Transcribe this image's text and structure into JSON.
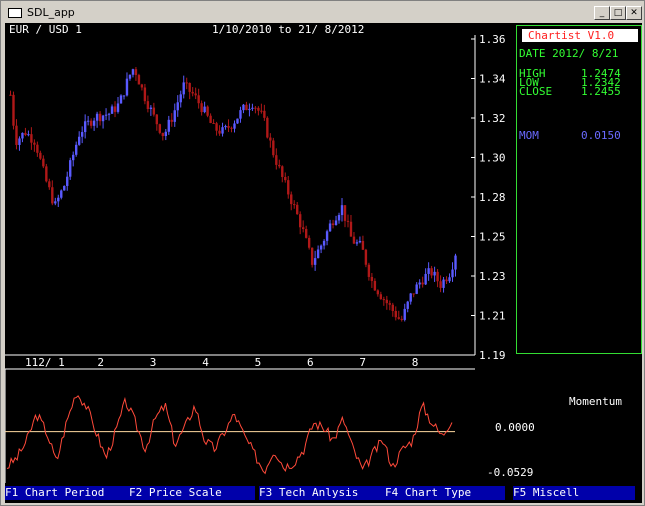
{
  "window": {
    "title": "SDL_app",
    "minimize": "_",
    "maximize": "□",
    "close": "✕"
  },
  "chart_header": {
    "pair": "EUR / USD 1",
    "range": "1/10/2010 to 21/ 8/2012"
  },
  "info_panel": {
    "app_name": "Chartist V1.0",
    "date": "DATE 2012/ 8/21",
    "high_label": "HIGH",
    "high": "1.2474",
    "low_label": "LOW",
    "low": "1.2342",
    "close_label": "CLOSE",
    "close": "1.2455",
    "mom_label": "MOM",
    "mom": "0.0150"
  },
  "indicator": {
    "name": "Momentum",
    "zero": "0.0000",
    "min": "-0.0529"
  },
  "function_keys": [
    "F1 Chart Period",
    "F2 Price Scale",
    "F3 Tech Anlysis",
    "F4 Chart Type",
    "F5 Miscell"
  ],
  "colors": {
    "up": "#5a5aff",
    "down": "#b01818",
    "panel_border": "#33dd33",
    "label_green": "#33ff33",
    "mom_blue": "#6a6aff",
    "title_red": "#ff2020",
    "momentum_line": "#ff4a3a"
  },
  "chart_data": {
    "type": "candlestick",
    "title": "EUR / USD 1",
    "subtitle": "1/10/2010 to 21/ 8/2012",
    "y_ticks": [
      "1.36",
      "1.34",
      "1.32",
      "1.30",
      "1.28",
      "1.25",
      "1.23",
      "1.21",
      "1.19"
    ],
    "x_ticks": [
      "112/ 1",
      "2",
      "3",
      "4",
      "5",
      "6",
      "7",
      "8"
    ],
    "ylim": [
      1.19,
      1.36
    ],
    "price_path": [
      [
        0,
        1.33
      ],
      [
        1,
        1.305
      ],
      [
        3,
        1.31
      ],
      [
        5,
        1.305
      ],
      [
        7,
        1.285
      ],
      [
        9,
        1.27
      ],
      [
        11,
        1.282
      ],
      [
        14,
        1.31
      ],
      [
        17,
        1.318
      ],
      [
        20,
        1.32
      ],
      [
        22,
        1.325
      ],
      [
        24,
        1.34
      ],
      [
        25,
        1.345
      ],
      [
        27,
        1.33
      ],
      [
        29,
        1.318
      ],
      [
        31,
        1.308
      ],
      [
        33,
        1.32
      ],
      [
        35,
        1.335
      ],
      [
        37,
        1.33
      ],
      [
        39,
        1.322
      ],
      [
        41,
        1.312
      ],
      [
        43,
        1.31
      ],
      [
        45,
        1.315
      ],
      [
        47,
        1.322
      ],
      [
        49,
        1.326
      ],
      [
        51,
        1.318
      ],
      [
        53,
        1.3
      ],
      [
        55,
        1.285
      ],
      [
        57,
        1.272
      ],
      [
        59,
        1.258
      ],
      [
        61,
        1.24
      ],
      [
        63,
        1.25
      ],
      [
        65,
        1.262
      ],
      [
        67,
        1.27
      ],
      [
        69,
        1.252
      ],
      [
        71,
        1.248
      ],
      [
        73,
        1.23
      ],
      [
        75,
        1.222
      ],
      [
        77,
        1.215
      ],
      [
        79,
        1.208
      ],
      [
        81,
        1.222
      ],
      [
        83,
        1.23
      ],
      [
        85,
        1.235
      ],
      [
        87,
        1.228
      ],
      [
        89,
        1.235
      ],
      [
        90,
        1.245
      ]
    ],
    "momentum": {
      "name": "Momentum",
      "ylim": [
        -0.0529,
        0.06
      ],
      "zero": 0.0,
      "last": 0.015,
      "path": [
        [
          0,
          -0.04
        ],
        [
          2,
          -0.03
        ],
        [
          4,
          -0.01
        ],
        [
          6,
          0.02
        ],
        [
          8,
          0.0
        ],
        [
          10,
          -0.035
        ],
        [
          12,
          0.01
        ],
        [
          14,
          0.045
        ],
        [
          16,
          0.03
        ],
        [
          18,
          0.0
        ],
        [
          20,
          -0.03
        ],
        [
          22,
          0.0
        ],
        [
          24,
          0.035
        ],
        [
          26,
          0.01
        ],
        [
          28,
          -0.02
        ],
        [
          30,
          0.015
        ],
        [
          32,
          0.03
        ],
        [
          34,
          -0.015
        ],
        [
          36,
          0.005
        ],
        [
          38,
          0.03
        ],
        [
          40,
          -0.01
        ],
        [
          42,
          -0.02
        ],
        [
          44,
          0.0
        ],
        [
          46,
          0.02
        ],
        [
          48,
          -0.005
        ],
        [
          50,
          -0.025
        ],
        [
          52,
          -0.045
        ],
        [
          54,
          -0.02
        ],
        [
          56,
          -0.04
        ],
        [
          58,
          -0.035
        ],
        [
          60,
          -0.02
        ],
        [
          62,
          0.01
        ],
        [
          64,
          0.005
        ],
        [
          66,
          -0.01
        ],
        [
          68,
          0.015
        ],
        [
          70,
          -0.02
        ],
        [
          72,
          -0.045
        ],
        [
          74,
          -0.025
        ],
        [
          76,
          -0.01
        ],
        [
          78,
          -0.04
        ],
        [
          80,
          -0.02
        ],
        [
          82,
          -0.01
        ],
        [
          84,
          0.03
        ],
        [
          86,
          0.01
        ],
        [
          88,
          -0.005
        ],
        [
          90,
          0.015
        ]
      ]
    }
  }
}
